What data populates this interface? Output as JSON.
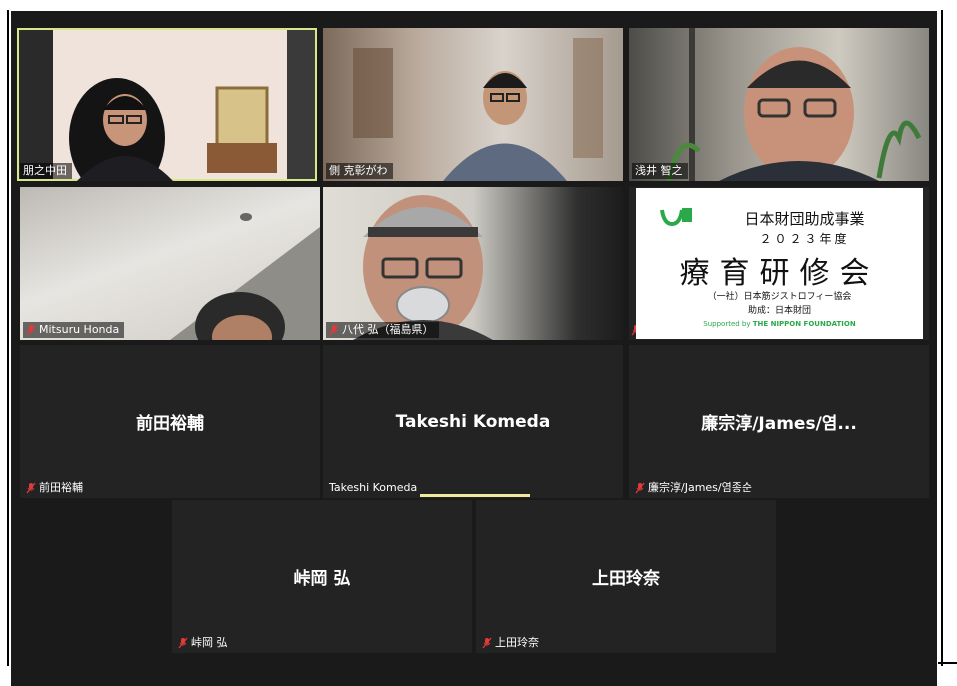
{
  "participants": [
    {
      "label": "朋之中田",
      "muted": false,
      "video": true,
      "active": true
    },
    {
      "label": "側 克彰がわ",
      "muted": false,
      "video": true
    },
    {
      "label": "浅井 智之",
      "muted": false,
      "video": true
    },
    {
      "label": "Mitsuru Honda",
      "muted": true,
      "video": true
    },
    {
      "label": "八代 弘（福島県）",
      "muted": true,
      "video": true
    },
    {
      "label": "",
      "muted": true,
      "video": true,
      "screen_share": true
    },
    {
      "label": "前田裕輔",
      "display_name": "前田裕輔",
      "muted": true,
      "video": false
    },
    {
      "label": "Takeshi Komeda",
      "display_name": "Takeshi Komeda",
      "muted": false,
      "video": false,
      "speaking": true
    },
    {
      "label": "廉宗淳/James/염종순",
      "display_name": "廉宗淳/James/염...",
      "muted": true,
      "video": false
    },
    {
      "label": "峠岡 弘",
      "display_name": "峠岡 弘",
      "muted": true,
      "video": false
    },
    {
      "label": "上田玲奈",
      "display_name": "上田玲奈",
      "muted": true,
      "video": false
    }
  ],
  "slide": {
    "header": "日本財団助成事業",
    "year": "２０２３年度",
    "title": "療育研修会",
    "org": "（一社）日本筋ジストロフィー協会",
    "grant": "助成：日本財団",
    "supported_by": "Supported by",
    "logo_text": "THE NIPPON FOUNDATION",
    "logo_small": "日本 財団"
  },
  "colors": {
    "active_border": "#d6e88a",
    "mute_red": "#e03a3a",
    "tile_bg": "#232323",
    "stage_bg": "#1a1a1a",
    "foundation_green": "#2aa84a"
  }
}
